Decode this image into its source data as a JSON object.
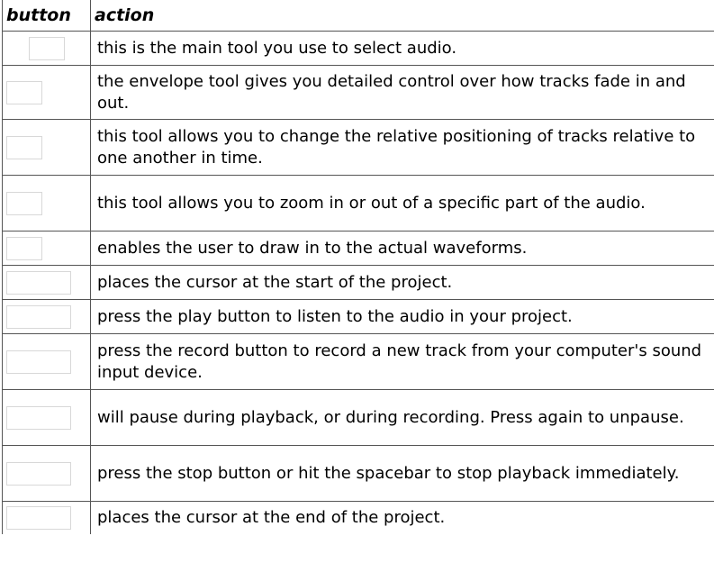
{
  "table": {
    "headers": [
      "button",
      "action"
    ],
    "rows": [
      {
        "action": "this is the main tool you use to select audio."
      },
      {
        "action": "the envelope tool gives you detailed control over how tracks fade in and out."
      },
      {
        "action": "this tool allows you to change the relative positioning of tracks relative to one another in time."
      },
      {
        "action": "this tool allows you to zoom in or out of a specific part of the audio."
      },
      {
        "action": "enables the user to draw in to the actual waveforms."
      },
      {
        "action": "places the cursor at the start of the project."
      },
      {
        "action": "press the play button to listen to the audio in your project."
      },
      {
        "action": "press the record button to record a new track from your computer's sound input device."
      },
      {
        "action": "will pause during playback, or during recording. Press again to unpause."
      },
      {
        "action": "press the stop button or hit the spacebar to stop playback immediately."
      },
      {
        "action": "places the cursor at the end of the project."
      }
    ]
  }
}
